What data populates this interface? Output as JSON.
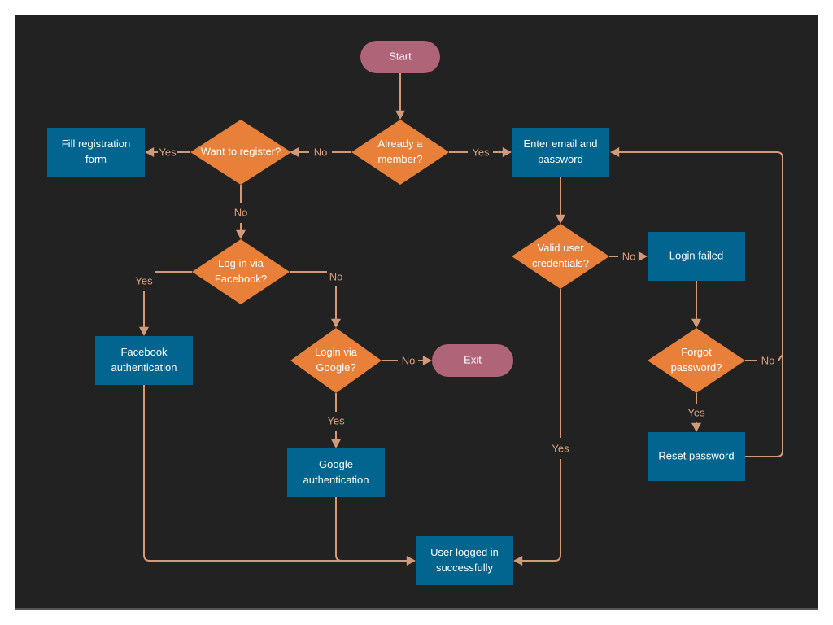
{
  "colors": {
    "background": "#222222",
    "terminal": "#b06478",
    "process": "#01658f",
    "decision": "#e8803a",
    "connector": "#d29a78",
    "text": "#ffffff",
    "label": "#d9a07c"
  },
  "nodes": {
    "start": {
      "type": "terminal",
      "lines": [
        "Start"
      ]
    },
    "already_member": {
      "type": "decision",
      "lines": [
        "Already a",
        "member?"
      ]
    },
    "want_register": {
      "type": "decision",
      "lines": [
        "Want to register?"
      ]
    },
    "fill_registration": {
      "type": "process",
      "lines": [
        "Fill registration",
        "form"
      ]
    },
    "login_facebook": {
      "type": "decision",
      "lines": [
        "Log in via",
        "Facebook?"
      ]
    },
    "facebook_auth": {
      "type": "process",
      "lines": [
        "Facebook",
        "authentication"
      ]
    },
    "login_google": {
      "type": "decision",
      "lines": [
        "Login via",
        "Google?"
      ]
    },
    "exit": {
      "type": "terminal",
      "lines": [
        "Exit"
      ]
    },
    "google_auth": {
      "type": "process",
      "lines": [
        "Google",
        "authentication"
      ]
    },
    "enter_email": {
      "type": "process",
      "lines": [
        "Enter email and",
        "password"
      ]
    },
    "valid_credentials": {
      "type": "decision",
      "lines": [
        "Valid user",
        "credentials?"
      ]
    },
    "login_failed": {
      "type": "process",
      "lines": [
        "Login failed"
      ]
    },
    "forgot_password": {
      "type": "decision",
      "lines": [
        "Forgot",
        "password?"
      ]
    },
    "reset_password": {
      "type": "process",
      "lines": [
        "Reset password"
      ]
    },
    "logged_in": {
      "type": "process",
      "lines": [
        "User logged in",
        "successfully"
      ]
    }
  },
  "edges": [
    {
      "from": "start",
      "to": "already_member",
      "label": ""
    },
    {
      "from": "already_member",
      "to": "want_register",
      "label": "No"
    },
    {
      "from": "already_member",
      "to": "enter_email",
      "label": "Yes"
    },
    {
      "from": "want_register",
      "to": "fill_registration",
      "label": "Yes"
    },
    {
      "from": "want_register",
      "to": "login_facebook",
      "label": "No"
    },
    {
      "from": "login_facebook",
      "to": "facebook_auth",
      "label": "Yes"
    },
    {
      "from": "login_facebook",
      "to": "login_google",
      "label": "No"
    },
    {
      "from": "login_google",
      "to": "exit",
      "label": "No"
    },
    {
      "from": "login_google",
      "to": "google_auth",
      "label": "Yes"
    },
    {
      "from": "facebook_auth",
      "to": "logged_in",
      "label": ""
    },
    {
      "from": "google_auth",
      "to": "logged_in",
      "label": ""
    },
    {
      "from": "enter_email",
      "to": "valid_credentials",
      "label": ""
    },
    {
      "from": "valid_credentials",
      "to": "login_failed",
      "label": "No"
    },
    {
      "from": "valid_credentials",
      "to": "logged_in",
      "label": "Yes"
    },
    {
      "from": "login_failed",
      "to": "forgot_password",
      "label": ""
    },
    {
      "from": "forgot_password",
      "to": "reset_password",
      "label": "Yes"
    },
    {
      "from": "forgot_password",
      "to": "enter_email",
      "label": "No"
    },
    {
      "from": "reset_password",
      "to": "enter_email",
      "label": ""
    }
  ]
}
